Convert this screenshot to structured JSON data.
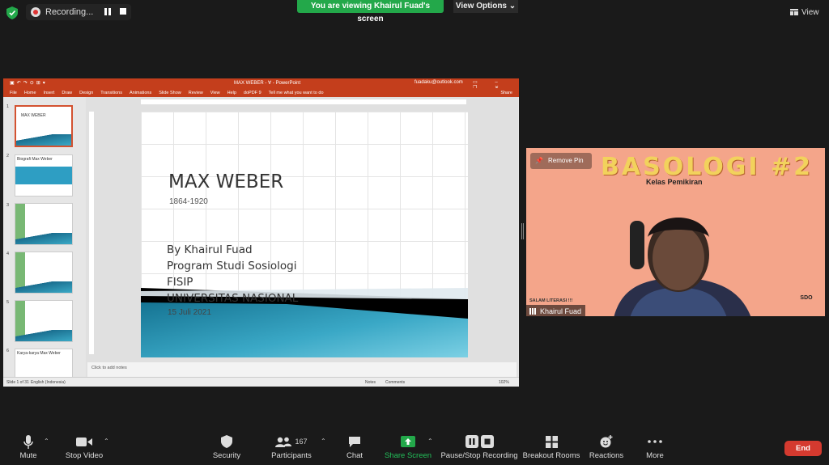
{
  "top": {
    "recording_label": "Recording...",
    "viewing_banner": "You are viewing Khairul Fuad's screen",
    "view_options": "View Options",
    "view": "View"
  },
  "ppt": {
    "window_title": "MAX WEBER",
    "app_name": "PowerPoint",
    "account": "fuadaku@outlook.com",
    "ribbon": [
      "File",
      "Home",
      "Insert",
      "Draw",
      "Design",
      "Transitions",
      "Animations",
      "Slide Show",
      "Review",
      "View",
      "Help",
      "doPDF 9",
      "Tell me what you want to do"
    ],
    "share": "Share",
    "thumbnails": [
      {
        "num": "1",
        "caption": "MAX WEBER"
      },
      {
        "num": "2",
        "caption": "Biografi Max Weber"
      },
      {
        "num": "3",
        "caption": ""
      },
      {
        "num": "4",
        "caption": ""
      },
      {
        "num": "5",
        "caption": ""
      },
      {
        "num": "6",
        "caption": "Karya-karya Max Weber"
      }
    ],
    "slide": {
      "title": "MAX WEBER",
      "years": "1864-1920",
      "author": "By Khairul Fuad",
      "program": "Program Studi Sosiologi",
      "faculty": "FISIP",
      "university": "UNIVERSITAS NASIONAL",
      "date": "15 Juli 2021"
    },
    "notes_placeholder": "Click to add notes",
    "status": {
      "slide_count": "Slide 1 of 31",
      "language": "English (Indonesia)",
      "notes": "Notes",
      "comments": "Comments",
      "zoom": "102%"
    }
  },
  "video": {
    "title": "BASOLOGI #2",
    "subtitle": "Kelas Pemikiran",
    "remove_pin": "Remove Pin",
    "salam": "SALAM LITERASI !!!",
    "logo_text": "SDO",
    "participant_name": "Khairul Fuad"
  },
  "toolbar": {
    "mute": "Mute",
    "stop_video": "Stop Video",
    "security": "Security",
    "participants": "Participants",
    "participant_count": "167",
    "chat": "Chat",
    "share_screen": "Share Screen",
    "recording": "Pause/Stop Recording",
    "breakout": "Breakout Rooms",
    "reactions": "Reactions",
    "more": "More",
    "end": "End"
  },
  "colors": {
    "share_green": "#23a84a",
    "ppt_orange": "#c43e1c",
    "end_red": "#d43a2f",
    "tile_bg": "#f4a58a"
  }
}
